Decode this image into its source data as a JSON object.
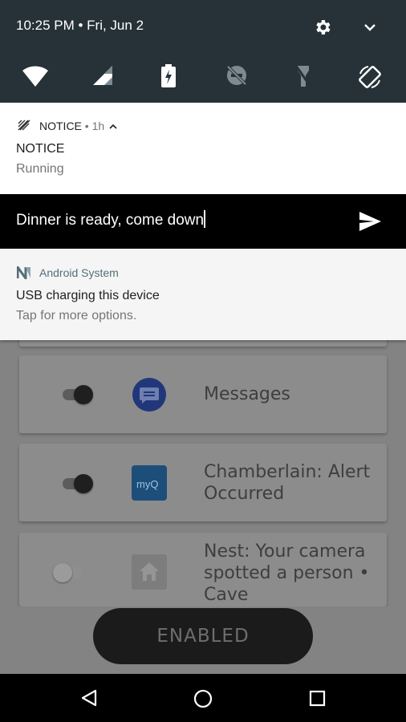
{
  "status": {
    "time_date": "10:25 PM • Fri, Jun 2"
  },
  "notice": {
    "app_name": "NOTICE",
    "age": "• 1h",
    "title": "NOTICE",
    "text": "Running"
  },
  "reply": {
    "value": "Dinner is ready, come down"
  },
  "android_system": {
    "app_name": "Android System",
    "title": "USB charging this device",
    "text": "Tap for more options."
  },
  "background_app": {
    "cards": [
      {
        "label": "Messages",
        "enabled": true
      },
      {
        "label": "Chamberlain: Alert Occurred",
        "enabled": true
      },
      {
        "label": "Nest: Your camera spotted a person • Cave",
        "enabled": false
      }
    ],
    "enabled_button": "ENABLED"
  },
  "colors": {
    "shade_header": "#263238",
    "accent_android": "#546e7a"
  },
  "icons": [
    "gear-icon",
    "chevron-down-icon",
    "wifi-icon",
    "signal-icon",
    "battery-charging-icon",
    "dnd-off-icon",
    "flashlight-off-icon",
    "auto-rotate-icon",
    "send-icon",
    "back-icon",
    "home-icon",
    "recents-icon"
  ]
}
